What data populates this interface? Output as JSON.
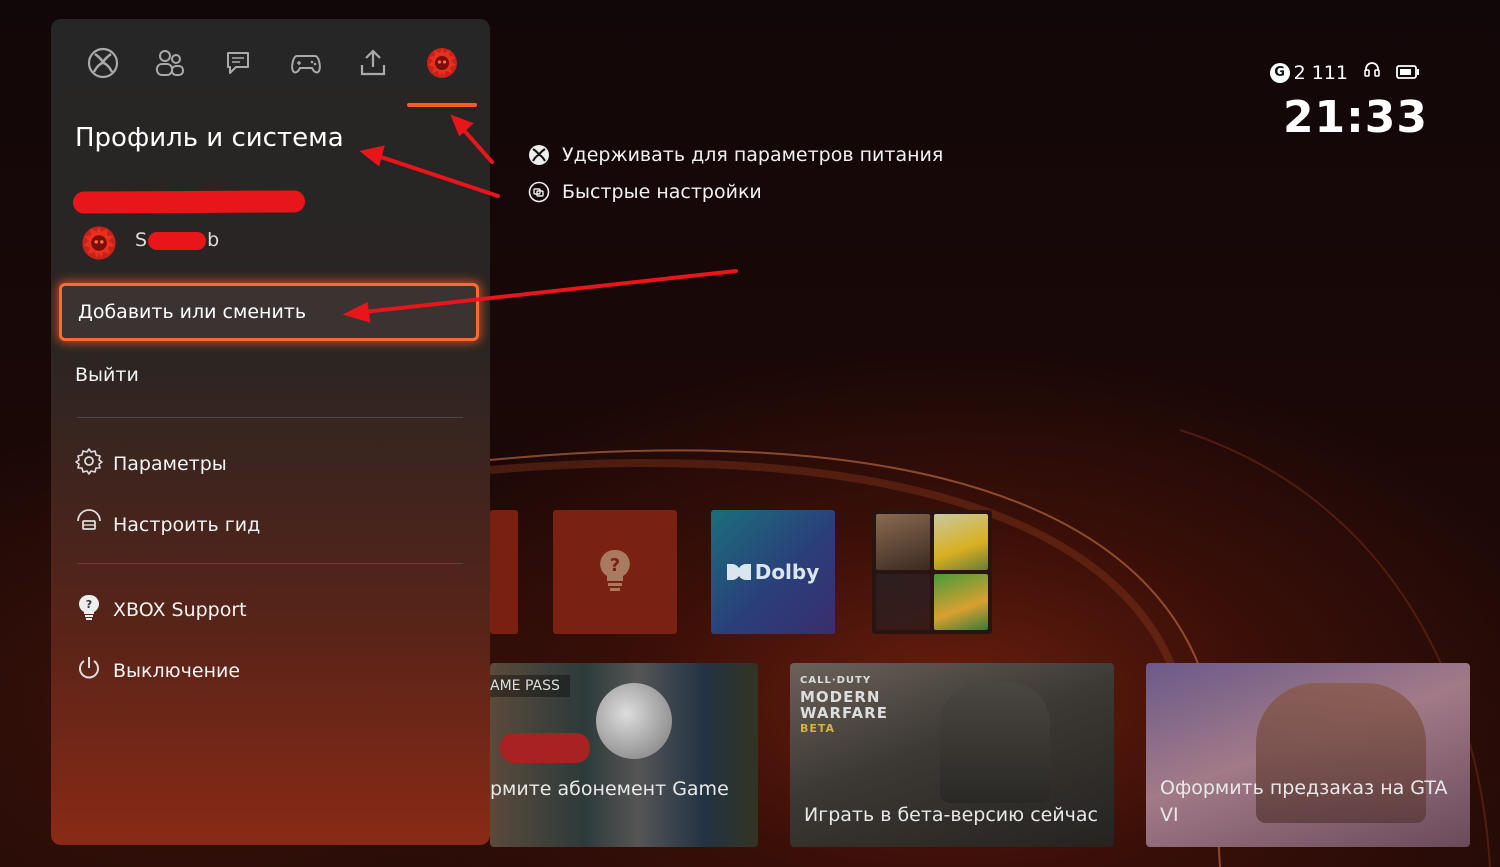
{
  "status": {
    "gamerscore": "2 111",
    "clock": "21:33"
  },
  "hints": [
    {
      "icon": "xbox-icon",
      "text": "Удерживать для параметров питания"
    },
    {
      "icon": "view-button-icon",
      "text": "Быстрые настройки"
    }
  ],
  "guide": {
    "tabs": [
      "xbox-icon",
      "people-icon",
      "chat-icon",
      "controller-icon",
      "share-icon",
      "profile-icon"
    ],
    "title": "Профиль и система",
    "username_start": "S",
    "username_end": "b",
    "switch_label": "Добавить или сменить",
    "signout_label": "Выйти",
    "settings_label": "Параметры",
    "customize_label": "Настроить гид",
    "support_label": "XBOX Support",
    "power_label": "Выключение"
  },
  "tiles": {
    "dolby_label": "Dolby"
  },
  "banners": {
    "gamepass_tag": "AME PASS",
    "gamepass_caption": "рмите абонемент Game",
    "mw_logo_line1": "CALL·DUTY",
    "mw_logo_line2": "MODERN",
    "mw_logo_line3": "WARFARE",
    "mw_logo_line4": "BETA",
    "mw_caption": "Играть в бета-версию сейчас",
    "gta_caption": "Оформить предзаказ на GTA VI"
  },
  "colors": {
    "accent": "#ff5a2a",
    "annotation": "#e8151b"
  }
}
